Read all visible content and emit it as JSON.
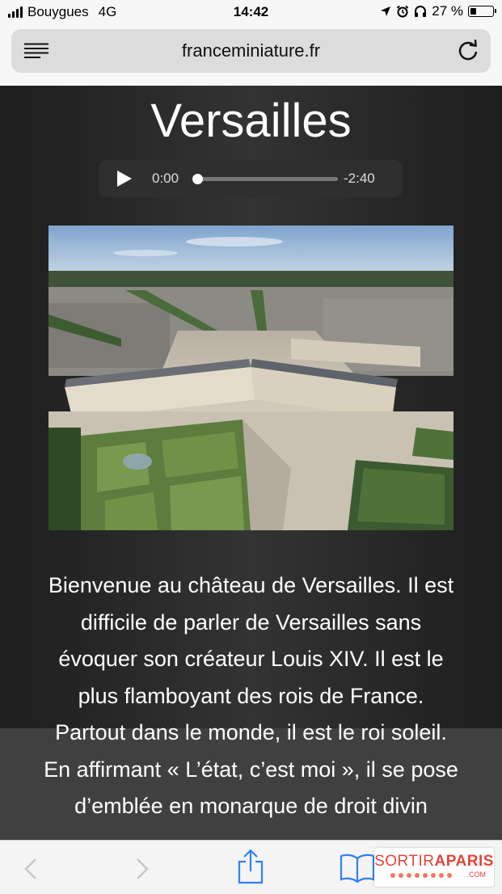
{
  "status_bar": {
    "carrier": "Bouygues",
    "network": "4G",
    "time": "14:42",
    "battery_text": "27 %",
    "battery_level": 0.27,
    "icons": [
      "location-icon",
      "alarm-icon",
      "headphones-icon"
    ]
  },
  "browser": {
    "url": "franceminiature.fr",
    "reader_icon": "reader-mode-icon",
    "reload_icon": "reload-icon"
  },
  "page": {
    "title": "Versailles",
    "audio": {
      "current_time": "0:00",
      "remaining_time": "-2:40",
      "progress": 0.0
    },
    "photo_alt": "château de Versailles",
    "description": "Bienvenue au château de Versailles. Il est difficile de parler de Versailles sans évoquer son créateur Louis XIV. Il est le plus flamboyant des rois de France. Partout dans le monde, il est le roi soleil. En affirmant « L’état, c’est moi », il se pose d’emblée en monarque de droit divin"
  },
  "toolbar": {
    "items": [
      "back-icon",
      "forward-icon",
      "share-icon",
      "bookmarks-icon"
    ]
  },
  "watermark": {
    "brand_light": "SORTIR",
    "brand_bold": "APARIS",
    "suffix": ".COM"
  },
  "colors": {
    "page_background": "#2b2b2b",
    "text": "#ffffff",
    "watermark_accent": "#e0463a",
    "ios_blue": "#2f7ff7"
  }
}
